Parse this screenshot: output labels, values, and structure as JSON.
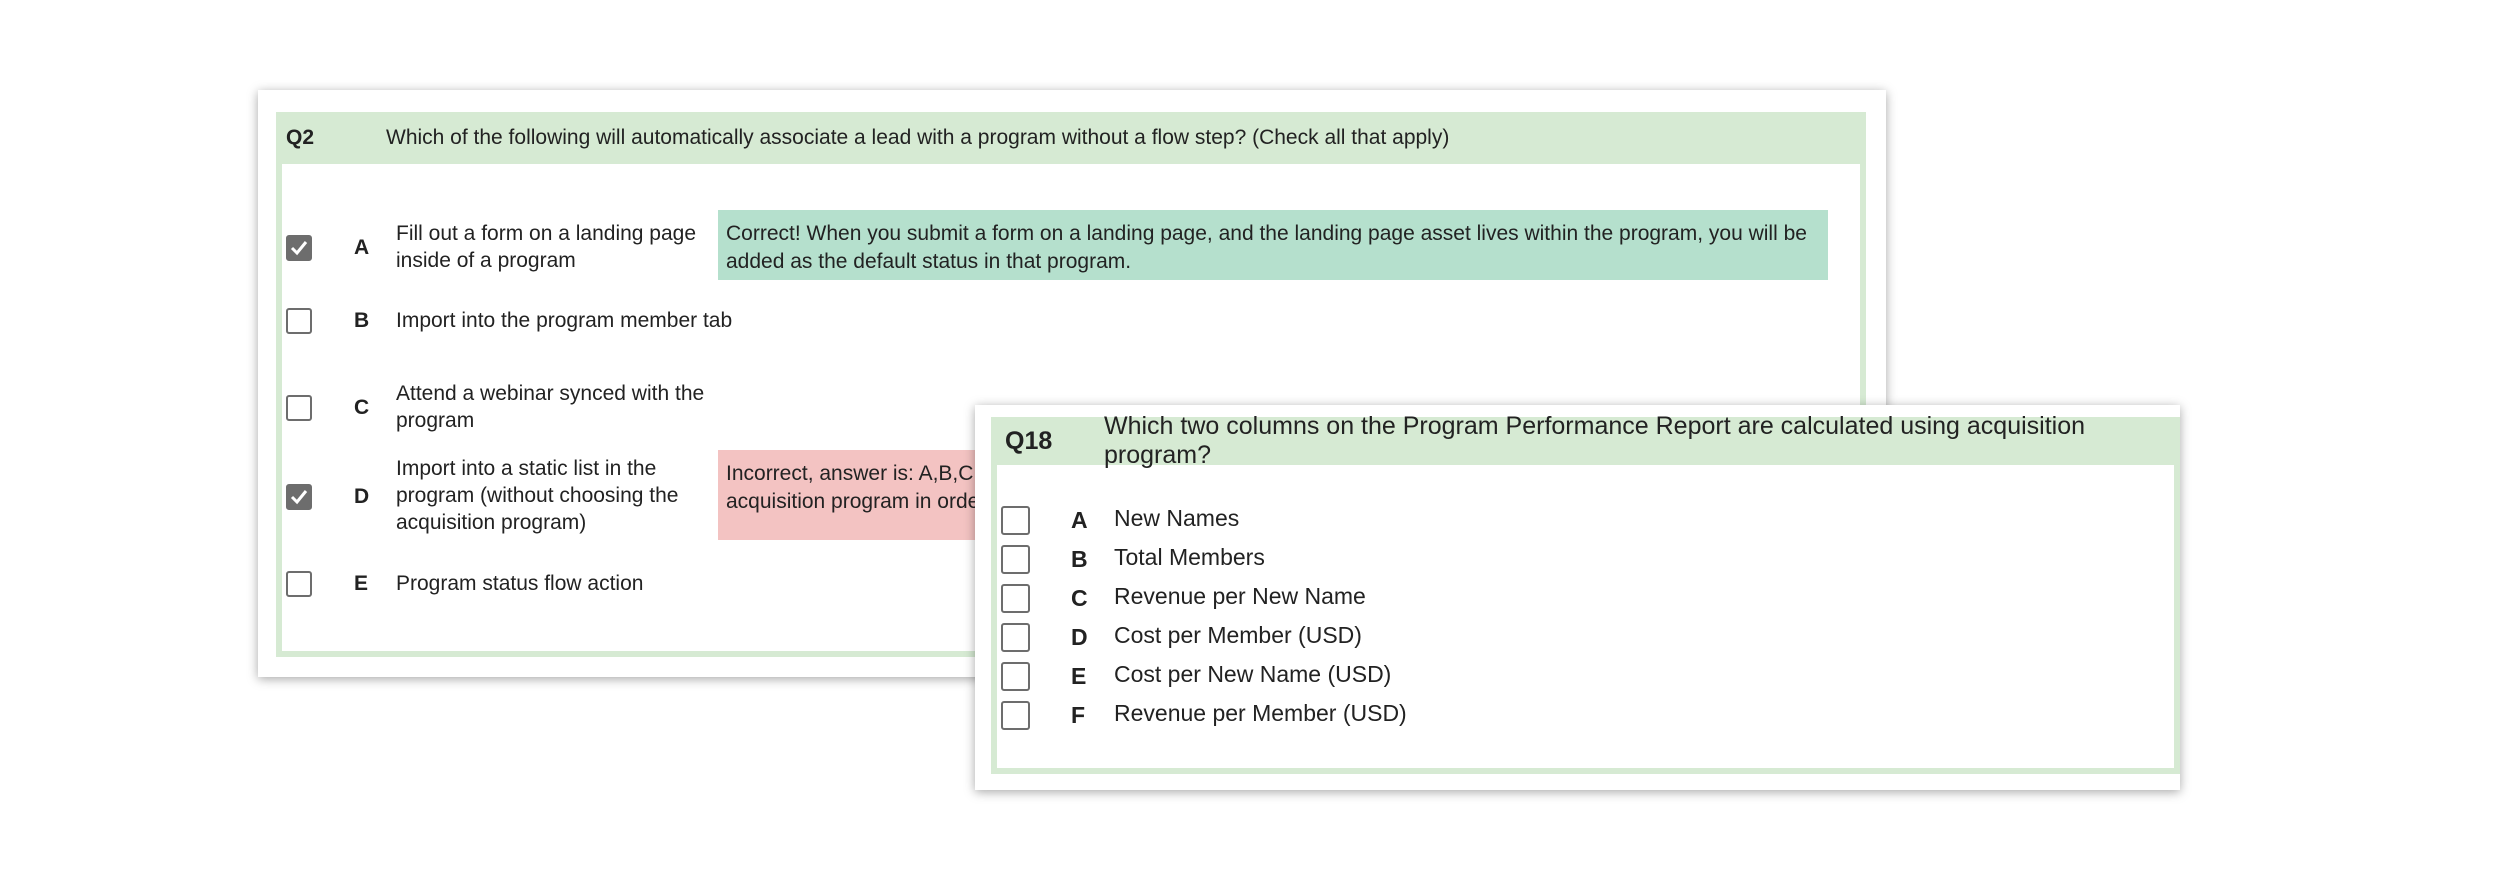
{
  "q2": {
    "number": "Q2",
    "question": "Which of the following will automatically associate a lead with a program without a flow step? (Check all that apply)",
    "options": [
      {
        "letter": "A",
        "text": "Fill out a form on a landing page inside of a program",
        "checked": true
      },
      {
        "letter": "B",
        "text": "Import into the program member tab",
        "checked": false
      },
      {
        "letter": "C",
        "text": "Attend a webinar synced with the program",
        "checked": false
      },
      {
        "letter": "D",
        "text": "Import into a static list in the program (without choosing the acquisition program)",
        "checked": true
      },
      {
        "letter": "E",
        "text": "Program status flow action",
        "checked": false
      }
    ],
    "feedback_correct": "Correct! When you submit a form on a landing page, and the landing page asset lives within the program, you will be added as the default status in that program.",
    "feedback_incorrect_line1": "Incorrect, answer is: A,B,C",
    "feedback_incorrect_line2": "acquisition program in orde",
    "colors": {
      "header": "#d6ead3",
      "correct": "#b5e0cd",
      "incorrect": "#f3c3c2",
      "checkbox": "#6d6d6d"
    }
  },
  "q18": {
    "number": "Q18",
    "question": "Which two columns on the Program Performance Report are calculated using acquisition program?",
    "options": [
      {
        "letter": "A",
        "text": "New Names",
        "checked": false
      },
      {
        "letter": "B",
        "text": "Total Members",
        "checked": false
      },
      {
        "letter": "C",
        "text": "Revenue per New Name",
        "checked": false
      },
      {
        "letter": "D",
        "text": "Cost per Member (USD)",
        "checked": false
      },
      {
        "letter": "E",
        "text": "Cost per New Name (USD)",
        "checked": false
      },
      {
        "letter": "F",
        "text": "Revenue per Member (USD)",
        "checked": false
      }
    ]
  }
}
